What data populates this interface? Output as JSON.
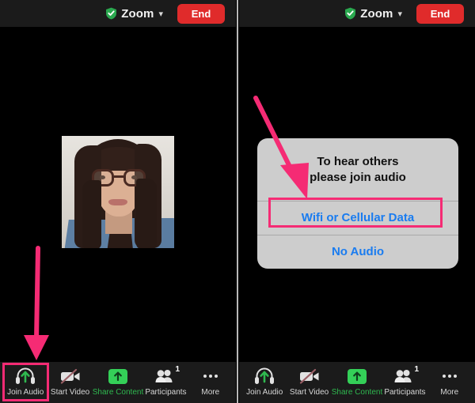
{
  "app": {
    "name": "Zoom",
    "accent_pink": "#f52b74",
    "accent_green": "#34d058",
    "accent_blue": "#1a7cf0",
    "end_red": "#e02b2b"
  },
  "topbar": {
    "shield_icon": "shield-check-icon",
    "title": "Zoom",
    "chevron_icon": "chevron-down-icon",
    "end_label": "End"
  },
  "left_panel": {
    "video_tile_alt": "self-video-thumbnail",
    "annotation_arrow": "pink-arrow-pointing-to-join-audio"
  },
  "right_panel": {
    "annotation_arrow": "pink-arrow-pointing-to-wifi-or-cellular-data",
    "dialog": {
      "title_line1": "To hear others",
      "title_line2": "please join audio",
      "actions": [
        {
          "label": "Wifi or Cellular Data",
          "highlighted": true
        },
        {
          "label": "No Audio",
          "highlighted": false
        }
      ]
    }
  },
  "toolbar": {
    "items": [
      {
        "label": "Join Audio",
        "icon": "headphones-join-audio-icon",
        "badge": null,
        "label_color": "gray"
      },
      {
        "label": "Start Video",
        "icon": "video-camera-off-icon",
        "badge": null,
        "label_color": "gray"
      },
      {
        "label": "Share Content",
        "icon": "share-content-up-arrow-icon",
        "badge": null,
        "label_color": "green"
      },
      {
        "label": "Participants",
        "icon": "participants-people-icon",
        "badge": "1",
        "label_color": "gray"
      },
      {
        "label": "More",
        "icon": "more-ellipsis-icon",
        "badge": null,
        "label_color": "gray"
      }
    ]
  }
}
